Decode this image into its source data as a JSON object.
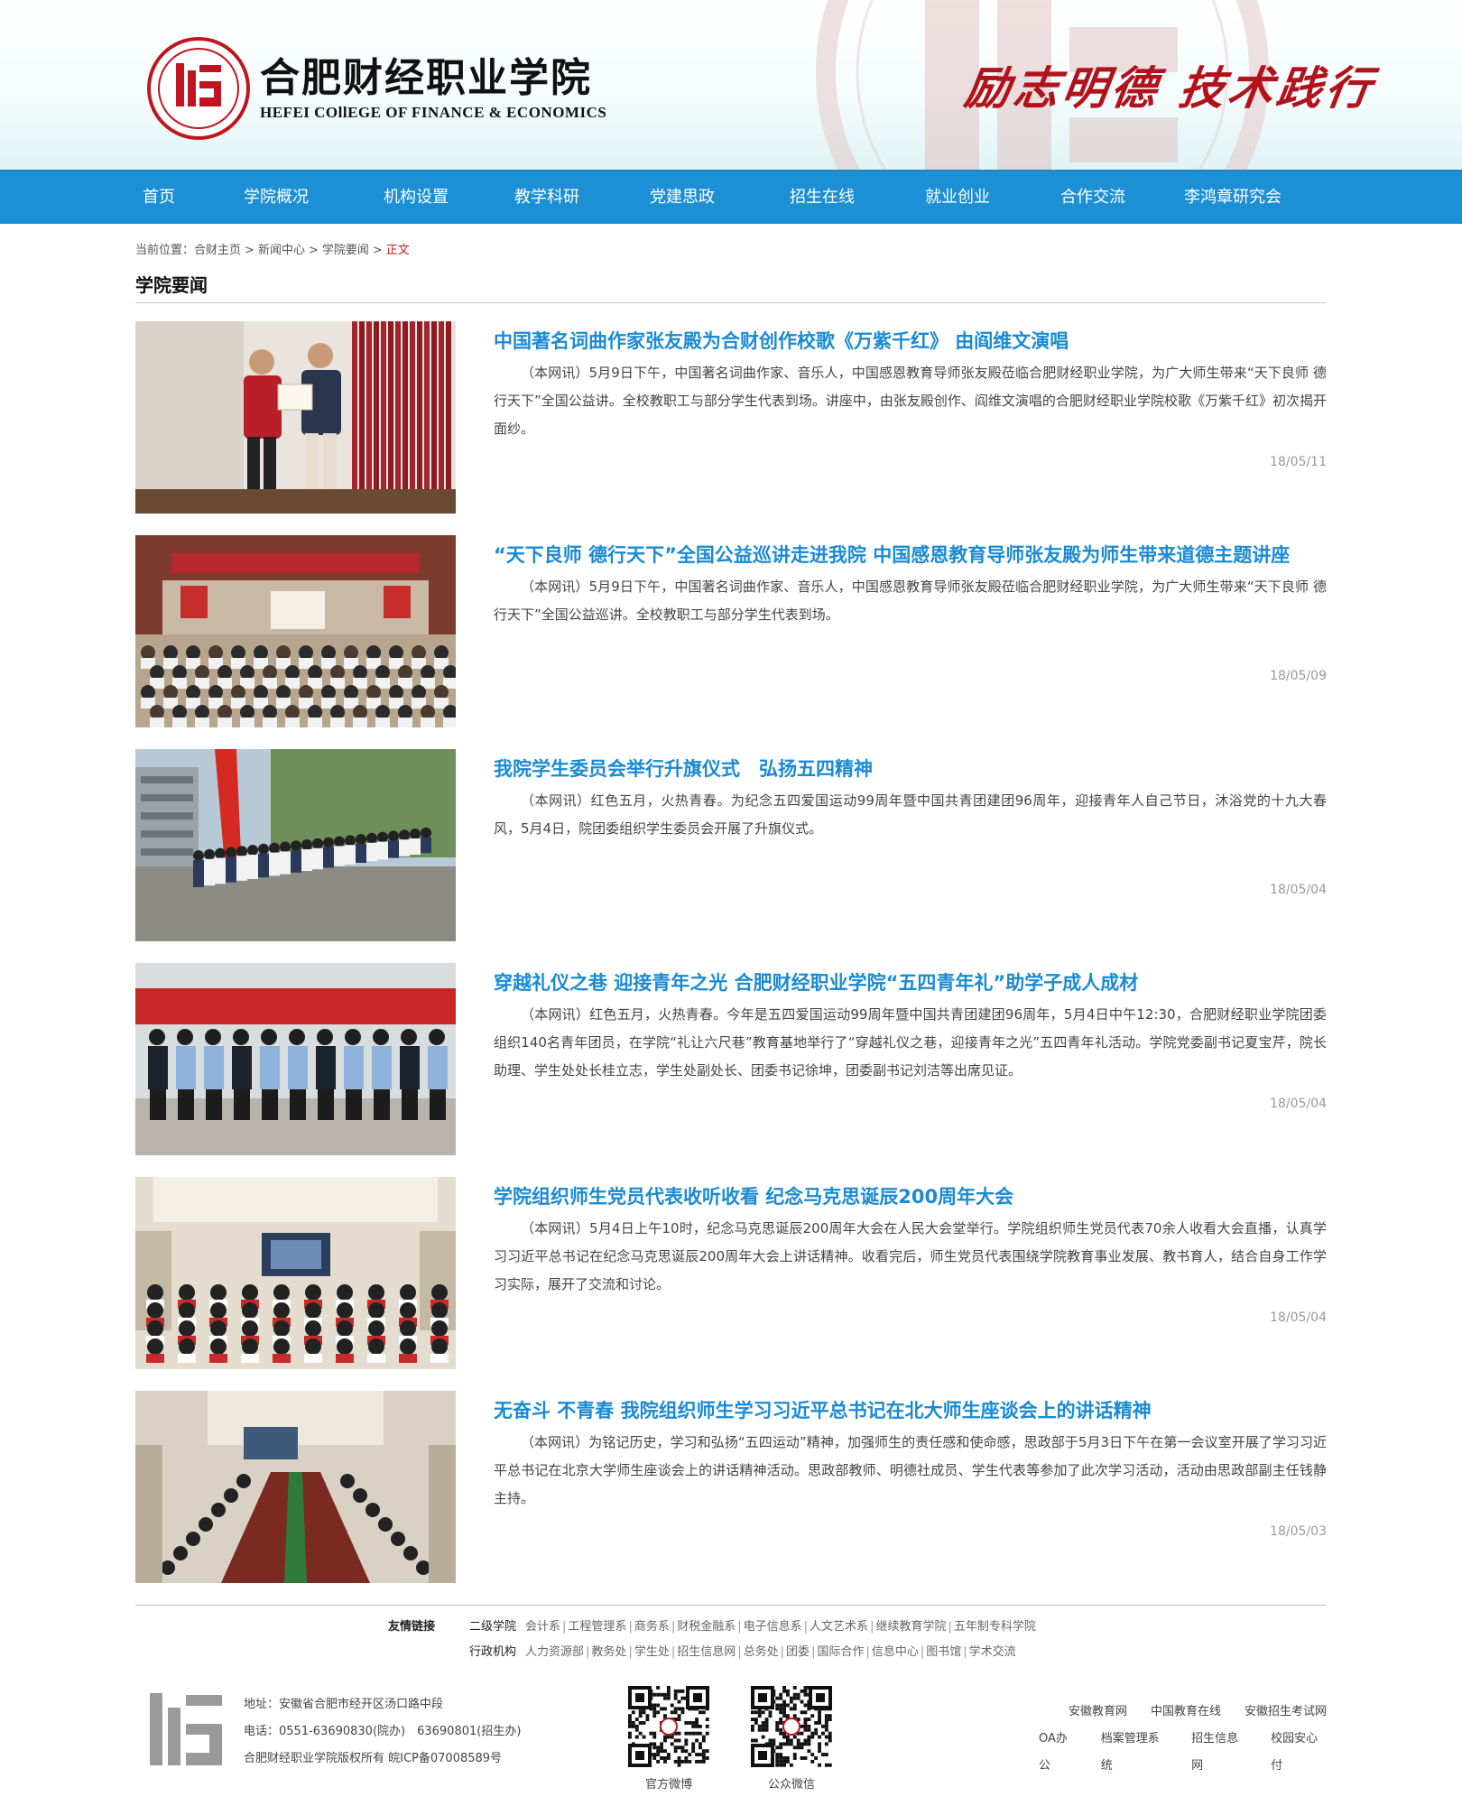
{
  "header": {
    "logo_cn": "合肥财经职业学院",
    "logo_en": "HEFEI COllEGE OF FINANCE & ECONOMICS",
    "motto": "励志明德 技术践行",
    "brand_color": "#b2121b"
  },
  "nav": {
    "color": "#1d8fd5",
    "items": [
      "首页",
      "学院概况",
      "机构设置",
      "教学科研",
      "党建思政",
      "招生在线",
      "就业创业",
      "合作交流",
      "李鸿章研究会"
    ]
  },
  "breadcrumb": {
    "prefix": "当前位置：",
    "items": [
      "合财主页",
      "新闻中心",
      "学院要闻"
    ],
    "separator": ">",
    "current": "正文"
  },
  "section_title": "学院要闻",
  "news": [
    {
      "title": "中国著名词曲作家张友殿为合财创作校歌《万紫千红》 由阎维文演唱",
      "summary": "（本网讯）5月9日下午，中国著名词曲作家、音乐人，中国感恩教育导师张友殿莅临合肥财经职业学院，为广大师生带来“天下良师 德行天下”全国公益讲。全校教职工与部分学生代表到场。讲座中，由张友殿创作、阎维文演唱的合肥财经职业学院校歌《万紫千红》初次揭开面纱。",
      "date": "18/05/11",
      "thumb": "stage-award-photo"
    },
    {
      "title": "“天下良师 德行天下”全国公益巡讲走进我院 中国感恩教育导师张友殿为师生带来道德主题讲座",
      "summary": "（本网讯）5月9日下午，中国著名词曲作家、音乐人，中国感恩教育导师张友殿莅临合肥财经职业学院，为广大师生带来“天下良师 德行天下”全国公益巡讲。全校教职工与部分学生代表到场。",
      "date": "18/05/09",
      "thumb": "auditorium-lecture-photo"
    },
    {
      "title": "我院学生委员会举行升旗仪式　弘扬五四精神",
      "summary": "（本网讯）红色五月，火热青春。为纪念五四爱国运动99周年暨中国共青团建团96周年，迎接青年人自己节日，沐浴党的十九大春风，5月4日，院团委组织学生委员会开展了升旗仪式。",
      "date": "18/05/04",
      "thumb": "flag-march-photo"
    },
    {
      "title": "穿越礼仪之巷 迎接青年之光 合肥财经职业学院“五四青年礼”助学子成人成材",
      "summary": "（本网讯）红色五月，火热青春。今年是五四爱国运动99周年暨中国共青团建团96周年，5月4日中午12:30，合肥财经职业学院团委组织140名青年团员，在学院“礼让六尺巷”教育基地举行了“穿越礼仪之巷，迎接青年之光”五四青年礼活动。学院党委副书记夏宝芹，院长助理、学生处处长桂立志，学生处副处长、团委书记徐坤，团委副书记刘洁等出席见证。",
      "date": "18/05/04",
      "thumb": "youth-oath-photo"
    },
    {
      "title": "学院组织师生党员代表收听收看 纪念马克思诞辰200周年大会",
      "summary": "（本网讯）5月4日上午10时，纪念马克思诞辰200周年大会在人民大会堂举行。学院组织师生党员代表70余人收看大会直播，认真学习习近平总书记在纪念马克思诞辰200周年大会上讲话精神。收看完后，师生党员代表围绕学院教育事业发展、教书育人，结合自身工作学习实际，展开了交流和讨论。",
      "date": "18/05/04",
      "thumb": "meeting-room-photo"
    },
    {
      "title": "无奋斗 不青春 我院组织师生学习习近平总书记在北大师生座谈会上的讲话精神",
      "summary": "（本网讯）为铭记历史，学习和弘扬“五四运动”精神，加强师生的责任感和使命感，思政部于5月3日下午在第一会议室开展了学习习近平总书记在北京大学师生座谈会上的讲话精神活动。思政部教师、明德社成员、学生代表等参加了此次学习活动，活动由思政部副主任钱静主持。",
      "date": "18/05/03",
      "thumb": "conference-table-photo"
    }
  ],
  "links": {
    "label": "友情链接",
    "rows": [
      {
        "category": "二级学院",
        "items": [
          "会计系",
          "工程管理系",
          "商务系",
          "财税金融系",
          "电子信息系",
          "人文艺术系",
          "继续教育学院",
          "五年制专科学院"
        ]
      },
      {
        "category": "行政机构",
        "items": [
          "人力资源部",
          "教务处",
          "学生处",
          "招生信息网",
          "总务处",
          "团委",
          "国际合作",
          "信息中心",
          "图书馆",
          "学术交流"
        ]
      }
    ]
  },
  "footer": {
    "address": "地址：安徽省合肥市经开区汤口路中段",
    "phone": "电话：0551-63690830(院办)　63690801(招生办)",
    "copyright": "合肥财经职业学院版权所有 皖ICP备07008589号",
    "qr_weibo_label": "官方微博",
    "qr_wechat_label": "公众微信",
    "links_row1": [
      "安徽教育网",
      "中国教育在线",
      "安徽招生考试网"
    ],
    "links_row2": [
      "OA办公",
      "档案管理系统",
      "招生信息网",
      "校园安心付"
    ]
  }
}
